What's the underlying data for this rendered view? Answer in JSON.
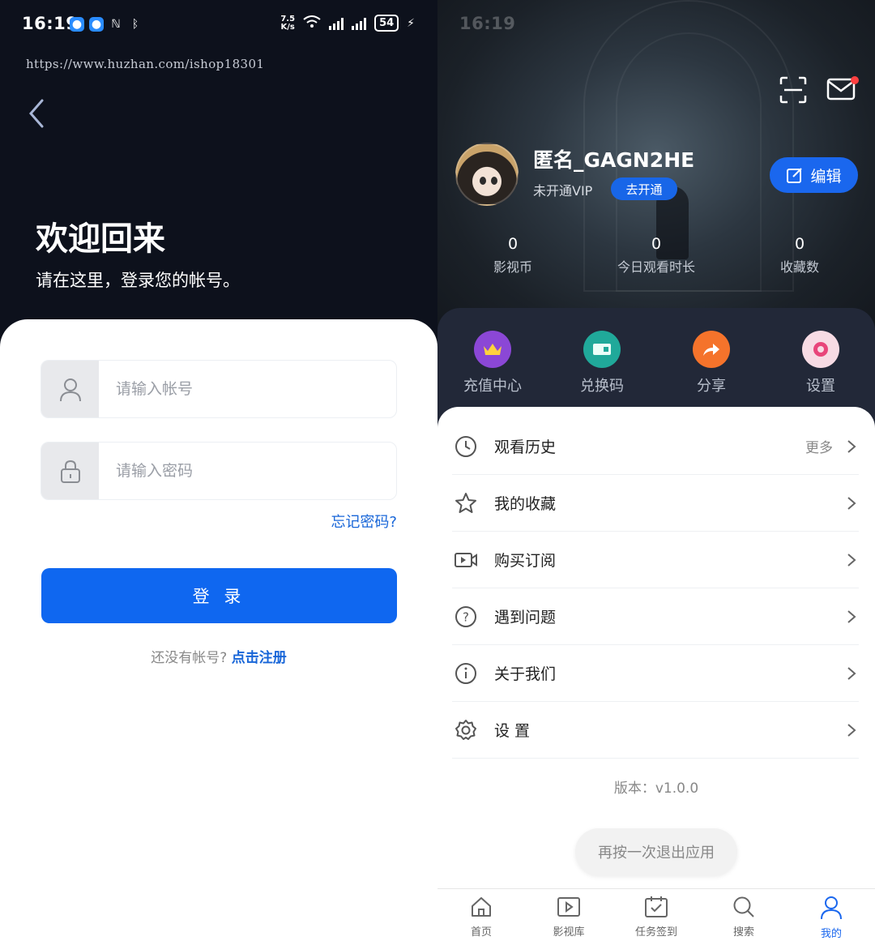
{
  "left_screen": {
    "status": {
      "time": "16:19",
      "speed": "7.5\nK/s",
      "battery": "54"
    },
    "url": "https://www.huzhan.com/ishop18301",
    "welcome_title": "欢迎回来",
    "welcome_subtitle": "请在这里，登录您的帐号。",
    "account_placeholder": "请输入帐号",
    "password_placeholder": "请输入密码",
    "forgot_link": "忘记密码?",
    "login_button": "登 录",
    "register_prompt": "还没有帐号?",
    "register_link": "点击注册"
  },
  "right_screen": {
    "profile": {
      "username": "匿名_GAGN2HE",
      "vip_status": "未开通VIP",
      "vip_button": "去开通",
      "edit_button": "编辑"
    },
    "stats": [
      {
        "value": "0",
        "label": "影视币"
      },
      {
        "value": "0",
        "label": "今日观看时长"
      },
      {
        "value": "0",
        "label": "收藏数"
      }
    ],
    "quick_actions": [
      {
        "label": "充值中心",
        "color": "#8b47d6"
      },
      {
        "label": "兑换码",
        "color": "#20a99a"
      },
      {
        "label": "分享",
        "color": "#f5732b"
      },
      {
        "label": "设置",
        "color": "#f3c9d6"
      }
    ],
    "menu": [
      {
        "label": "观看历史",
        "more": "更多"
      },
      {
        "label": "我的收藏",
        "more": ""
      },
      {
        "label": "购买订阅",
        "more": ""
      },
      {
        "label": "遇到问题",
        "more": ""
      },
      {
        "label": "关于我们",
        "more": ""
      },
      {
        "label": "设 置",
        "more": ""
      }
    ],
    "version": "版本：v1.0.0",
    "toast": "再按一次退出应用",
    "tabs": [
      {
        "label": "首页",
        "icon": "home-icon"
      },
      {
        "label": "影视库",
        "icon": "video-library-icon"
      },
      {
        "label": "任务签到",
        "icon": "checkin-icon"
      },
      {
        "label": "搜索",
        "icon": "search-icon"
      },
      {
        "label": "我的",
        "icon": "user-icon",
        "active": true
      }
    ]
  },
  "colors": {
    "accent": "#0f67f0",
    "link": "#1765d8",
    "dark_bg": "#0d111c",
    "panel": "#222838"
  }
}
